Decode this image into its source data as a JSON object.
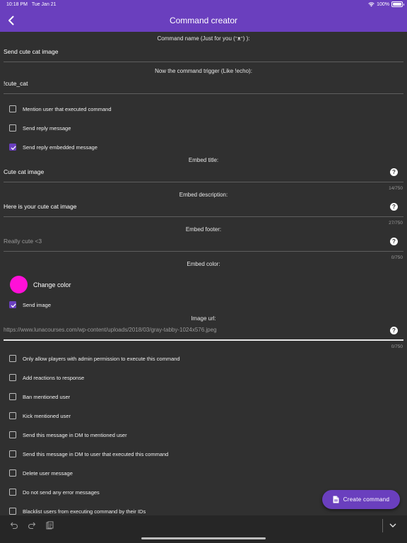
{
  "status_bar": {
    "time": "10:18 PM",
    "date": "Tue Jan 21",
    "battery": "100%"
  },
  "app_bar": {
    "title": "Command creator"
  },
  "command_name": {
    "label": "Command name (Just for you (ᵔᴥᵔ) ):",
    "value": "Send cute cat image"
  },
  "command_trigger": {
    "label": "Now the command trigger (Like !echo):",
    "value": "!cute_cat"
  },
  "options_top": [
    {
      "label": "Mention user that executed command",
      "checked": false
    },
    {
      "label": "Send reply message",
      "checked": false
    },
    {
      "label": "Send reply embedded message",
      "checked": true
    }
  ],
  "embed_title": {
    "label": "Embed title:",
    "value": "Cute cat image",
    "counter": "14/750"
  },
  "embed_description": {
    "label": "Embed description:",
    "value": "Here is your cute cat image",
    "counter": "27/750"
  },
  "embed_footer": {
    "label": "Embed footer:",
    "placeholder": "Really cute <3",
    "counter": "0/750"
  },
  "embed_color": {
    "label": "Embed color:",
    "button_label": "Change color",
    "color": "#ff10d8"
  },
  "send_image": {
    "label": "Send image",
    "checked": true
  },
  "image_url": {
    "label": "Image url:",
    "placeholder": "https://www.lunacourses.com/wp-content/uploads/2018/03/gray-tabby-1024x576.jpeg",
    "counter": "0/750"
  },
  "options_bottom": [
    {
      "label": "Only allow players with admin permission to execute this command",
      "checked": false
    },
    {
      "label": "Add reactions to response",
      "checked": false
    },
    {
      "label": "Ban mentioned user",
      "checked": false
    },
    {
      "label": "Kick mentioned user",
      "checked": false
    },
    {
      "label": "Send this message in DM to mentioned user",
      "checked": false
    },
    {
      "label": "Send this message in DM to user that executed this command",
      "checked": false
    },
    {
      "label": "Delete user message",
      "checked": false
    },
    {
      "label": "Do not send any error messages",
      "checked": false
    },
    {
      "label": "Blacklist users from executing command by their IDs",
      "checked": false
    }
  ],
  "fab": {
    "label": "Create command",
    "icon": "document-icon"
  },
  "colors": {
    "accent": "#6a3fbe",
    "background": "#303030"
  }
}
